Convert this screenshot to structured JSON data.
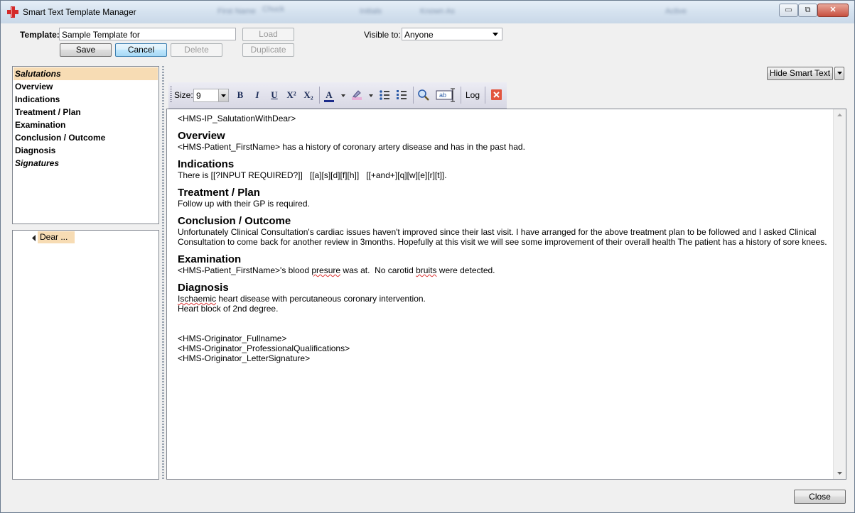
{
  "window": {
    "title": "Smart Text Template Manager",
    "minimize": "▭",
    "maximize": "⧉",
    "close": "✕"
  },
  "title_bar_blurred": [
    "First Name",
    "Chuck",
    "Initials",
    "Known As",
    "Active"
  ],
  "form": {
    "template_label": "Template:",
    "template_value": "Sample Template for",
    "visible_label": "Visible to:",
    "visible_value": "Anyone",
    "buttons": {
      "load": "Load",
      "save": "Save",
      "cancel": "Cancel",
      "delete": "Delete",
      "duplicate": "Duplicate"
    }
  },
  "sections": [
    "Salutations",
    "Overview",
    "Indications",
    "Treatment / Plan",
    "Examination",
    "Conclusion / Outcome",
    "Diagnosis",
    "Signatures"
  ],
  "tree": {
    "node_label": "Dear ..."
  },
  "hide_smart_text": "Hide Smart Text",
  "toolbar": {
    "size_label": "Size:",
    "size_value": "9",
    "bold": "B",
    "italic": "I",
    "underline": "U",
    "superscript": "X²",
    "subscript": "X₂",
    "font_color": "A",
    "log": "Log"
  },
  "document": {
    "salutation": "<HMS-IP_SalutationWithDear>",
    "overview_heading": "Overview",
    "overview_text": "<HMS-Patient_FirstName> has a history of coronary artery disease and has in the past had.",
    "indications_heading": "Indications",
    "indications_text": "There is [[?INPUT REQUIRED?]]   [[a][s][d][f][h]]   [[+and+][q][w][e][r][t]].",
    "treatment_heading": "Treatment / Plan",
    "treatment_text": "Follow up with their GP is required.",
    "conclusion_heading": "Conclusion / Outcome",
    "conclusion_text": "Unfortunately Clinical Consultation's cardiac issues haven't improved since their last visit. I have arranged for the above treatment plan to be followed and I asked Clinical Consultation to come back for another review in 3months. Hopefully at this visit we will see some improvement of their overall health The patient has a history of sore knees.",
    "examination_heading": "Examination",
    "examination_pre": "<HMS-Patient_FirstName>'s blood ",
    "examination_squig1": "presure",
    "examination_mid": " was at.  No carotid ",
    "examination_squig2": "bruits",
    "examination_post": " were detected.",
    "diagnosis_heading": "Diagnosis",
    "diagnosis_squig": "Ischaemic",
    "diagnosis_line1_rest": " heart disease with percutaneous coronary intervention.",
    "diagnosis_line2": "Heart block of 2nd degree.",
    "sig1": "<HMS-Originator_Fullname>",
    "sig2": "<HMS-Originator_ProfessionalQualifications>",
    "sig3": "<HMS-Originator_LetterSignature>"
  },
  "footer": {
    "close": "Close"
  },
  "colors": {
    "selected_section": "#f7dcb4",
    "title_bar": "#d5e2ef",
    "accent_blue": "#3c7fb1"
  }
}
